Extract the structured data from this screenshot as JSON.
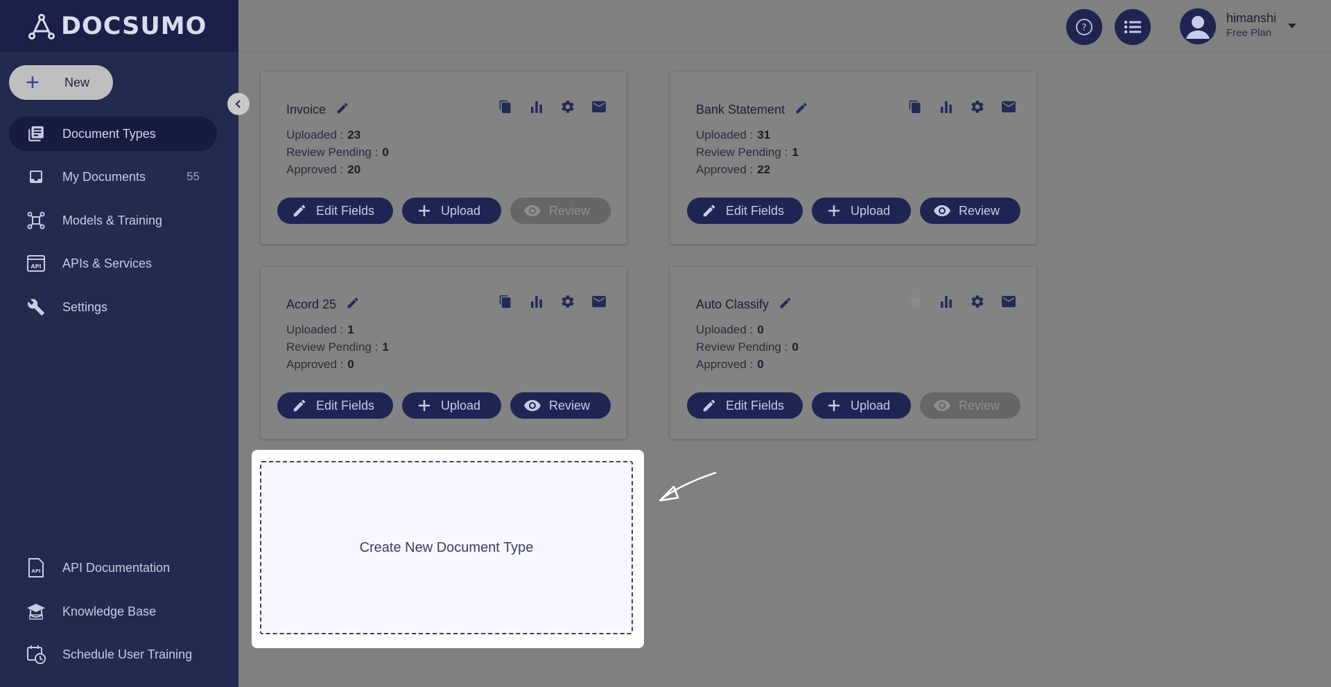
{
  "brand": {
    "name": "DOCSUMO"
  },
  "sidebar": {
    "new_label": "New",
    "items": [
      {
        "label": "Document Types",
        "icon": "library-books-icon",
        "active": true
      },
      {
        "label": "My Documents",
        "icon": "inbox-icon",
        "count": "55"
      },
      {
        "label": "Models & Training",
        "icon": "ai-model-icon"
      },
      {
        "label": "APIs & Services",
        "icon": "api-icon"
      },
      {
        "label": "Settings",
        "icon": "tools-icon"
      }
    ],
    "bottom_items": [
      {
        "label": "API Documentation",
        "icon": "api-doc-icon"
      },
      {
        "label": "Knowledge Base",
        "icon": "graduation-cap-icon"
      },
      {
        "label": "Schedule User Training",
        "icon": "calendar-clock-icon"
      }
    ]
  },
  "header": {
    "user": {
      "name": "himanshi",
      "plan": "Free Plan"
    }
  },
  "labels": {
    "uploaded": "Uploaded :",
    "review_pending": "Review Pending :",
    "approved": "Approved :",
    "edit_fields": "Edit Fields",
    "upload": "Upload",
    "review": "Review"
  },
  "cards": [
    {
      "title": "Invoice",
      "uploaded": "23",
      "review_pending": "0",
      "approved": "20",
      "review_enabled": false
    },
    {
      "title": "Bank Statement",
      "uploaded": "31",
      "review_pending": "1",
      "approved": "22",
      "review_enabled": true
    },
    {
      "title": "Acord 25",
      "uploaded": "1",
      "review_pending": "1",
      "approved": "0",
      "review_enabled": true
    },
    {
      "title": "Auto Classify",
      "uploaded": "0",
      "review_pending": "0",
      "approved": "0",
      "review_enabled": false
    }
  ],
  "create": {
    "label": "Create New Document Type"
  },
  "colors": {
    "sidebar": "#232a4f",
    "accent": "#1f2553",
    "overlay": "#808080"
  }
}
